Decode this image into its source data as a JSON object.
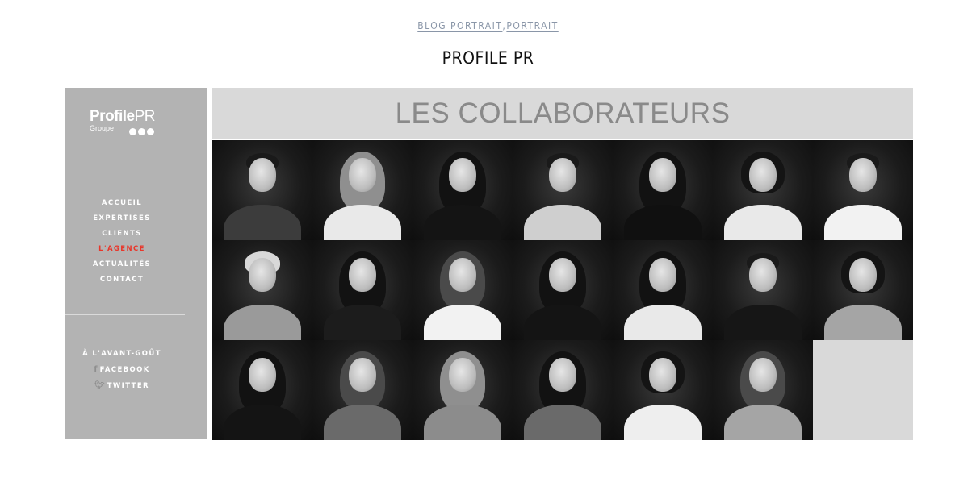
{
  "categories": {
    "items": [
      "BLOG PORTRAIT",
      "PORTRAIT"
    ],
    "separator": ","
  },
  "post_title": "PROFILE PR",
  "sidebar": {
    "logo": {
      "brand_a": "Profile",
      "brand_b": "PR",
      "sub": "Groupe"
    },
    "nav": [
      {
        "label": "ACCUEIL",
        "active": false
      },
      {
        "label": "EXPERTISES",
        "active": false
      },
      {
        "label": "CLIENTS",
        "active": false
      },
      {
        "label": "L'AGENCE",
        "active": true
      },
      {
        "label": "ACTUALITÉS",
        "active": false
      },
      {
        "label": "CONTACT",
        "active": false
      }
    ],
    "social": [
      {
        "label": "À L'AVANT-GOÛT",
        "icon": ""
      },
      {
        "label": "FACEBOOK",
        "icon": "facebook-icon"
      },
      {
        "label": "TWITTER",
        "icon": "twitter-icon"
      }
    ]
  },
  "banner_title": "LES COLLABORATEURS",
  "portraits": [
    {
      "hair": "short-dark",
      "top": "dark-shirt"
    },
    {
      "hair": "long-light",
      "top": "white-top"
    },
    {
      "hair": "long-dark",
      "top": "black-top"
    },
    {
      "hair": "short-dark",
      "top": "check-shirt"
    },
    {
      "hair": "long-dark",
      "top": "black-dress"
    },
    {
      "hair": "bob-dark",
      "top": "white-top"
    },
    {
      "hair": "short-dark",
      "top": "white-shirt"
    },
    {
      "hair": "short-light",
      "top": "grey-jacket"
    },
    {
      "hair": "long-dark",
      "top": "black-jacket"
    },
    {
      "hair": "long-mid",
      "top": "white-shirt"
    },
    {
      "hair": "long-dark",
      "top": "black-top"
    },
    {
      "hair": "long-dark",
      "top": "white-top"
    },
    {
      "hair": "short-dark",
      "top": "black-suit"
    },
    {
      "hair": "bob-dark",
      "top": "grey-cardigan"
    },
    {
      "hair": "long-dark",
      "top": "black-top"
    },
    {
      "hair": "long-mid",
      "top": "pattern-top"
    },
    {
      "hair": "long-light",
      "top": "denim-jacket"
    },
    {
      "hair": "long-dark",
      "top": "pattern-top"
    },
    {
      "hair": "bob-dark",
      "top": "white-black-top"
    },
    {
      "hair": "long-mid",
      "top": "grey-cardigan"
    },
    {
      "hair": "none",
      "top": "none"
    }
  ],
  "colors": {
    "sidebar_bg": "#b3b3b3",
    "banner_bg": "#d9d9d9",
    "active_nav": "#e8362a",
    "category_link": "#8a96a8"
  }
}
